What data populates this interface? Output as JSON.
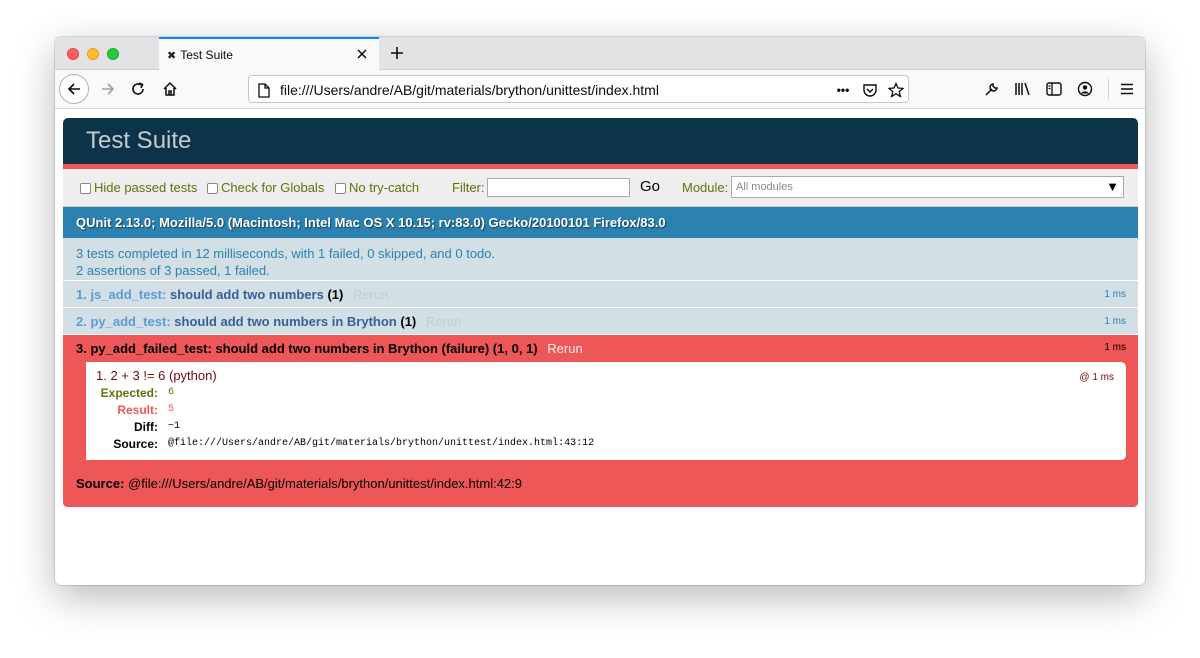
{
  "browser": {
    "tab": {
      "favicon": "✖",
      "title": "Test Suite"
    },
    "url": "file:///Users/andre/AB/git/materials/brython/unittest/index.html",
    "url_more": "•••"
  },
  "qunit": {
    "title": "Test Suite",
    "toolbar": {
      "hide_passed": "Hide passed tests",
      "check_globals": "Check for Globals",
      "no_try_catch": "No try-catch",
      "filter_label": "Filter:",
      "filter_value": "",
      "go_label": "Go",
      "module_label": "Module:",
      "module_selected": "All modules",
      "module_caret": "▼"
    },
    "useragent": "QUnit 2.13.0; Mozilla/5.0 (Macintosh; Intel Mac OS X 10.15; rv:83.0) Gecko/20100101 Firefox/83.0",
    "result_line1": "3 tests completed in 12 milliseconds, with 1 failed, 0 skipped, and 0 todo.",
    "result_line2": "2 assertions of 3 passed, 1 failed.",
    "tests": [
      {
        "num": "1.",
        "module": "js_add_test:",
        "name": "should add two numbers",
        "count": "(1)",
        "rerun": "Rerun",
        "runtime": "1 ms"
      },
      {
        "num": "2.",
        "module": "py_add_test:",
        "name": "should add two numbers in Brython",
        "count": "(1)",
        "rerun": "Rerun",
        "runtime": "1 ms"
      }
    ],
    "failed_test": {
      "head": "3. py_add_failed_test: should add two numbers in Brython (failure)",
      "paren_open": " (",
      "failed": "1",
      "comma1": ", ",
      "passed": "0",
      "comma2": ", ",
      "total": "1",
      "paren_close": ")",
      "rerun": "Rerun",
      "runtime": "1 ms",
      "assertion": {
        "message": "1. 2 + 3 != 6 (python)",
        "time": "@ 1 ms",
        "expected_label": "Expected:",
        "expected": "6",
        "result_label": "Result:",
        "result": "5",
        "diff_label": "Diff:",
        "diff": "−1",
        "source_label": "Source:",
        "source": "@file:///Users/andre/AB/git/materials/brython/unittest/index.html:43:12"
      },
      "source_label": "Source:",
      "source": " @file:///Users/andre/AB/git/materials/brython/unittest/index.html:42:9"
    }
  },
  "icons": [
    "close-icon",
    "plus-icon",
    "back-arrow-icon",
    "forward-arrow-icon",
    "reload-icon",
    "home-icon",
    "page-icon",
    "more-dots-icon",
    "pocket-icon",
    "star-icon",
    "wrench-icon",
    "library-icon",
    "sidebar-icon",
    "account-icon",
    "hamburger-menu-icon"
  ],
  "colors": {
    "header": "#0d3349",
    "fail": "#ee5757",
    "useragent": "#2b81af",
    "result_bg": "#d2e0e6",
    "tab_accent": "#0a84ff"
  }
}
